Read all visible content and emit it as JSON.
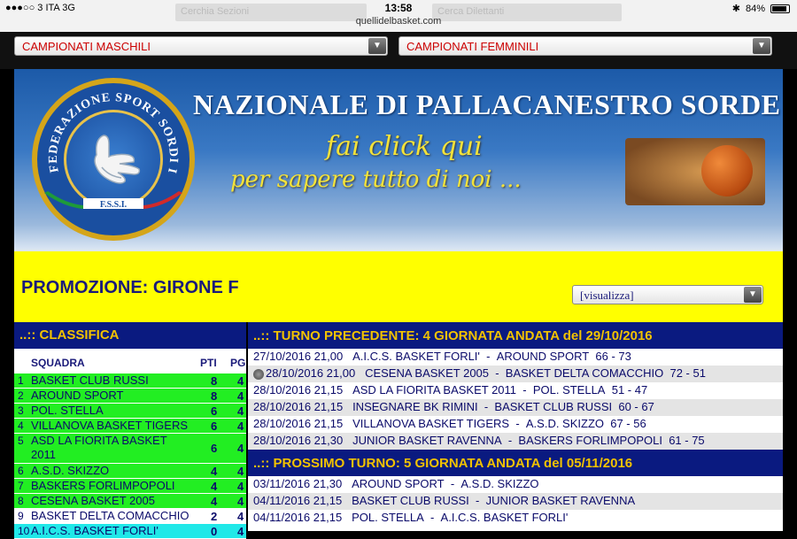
{
  "status_bar": {
    "carrier": "●●●○○ 3 ITA  3G",
    "time": "13:58",
    "url": "quellidelbasket.com",
    "bluetooth": "✱",
    "battery": "84%"
  },
  "top_nav": {
    "ghost_left": "Cerchia Sezioni",
    "ghost_right": "Cerca Dilettanti",
    "maschili": "CAMPIONATI MASCHILI",
    "femminili": "CAMPIONATI FEMMINILI"
  },
  "banner": {
    "seal_text": "FEDERAZIONE SPORT SORDI ITALIA",
    "seal_abbr": "F.S.S.I.",
    "title": "NAZIONALE DI PALLACANESTRO SORDE",
    "line1": "fai click qui",
    "line2": "per sapere tutto di noi ..."
  },
  "league": {
    "title": "PROMOZIONE: GIRONE F",
    "select_value": "[visualizza]"
  },
  "classifica": {
    "title": "..:: CLASSIFICA",
    "col_team": "SQUADRA",
    "col_pti": "PTI",
    "col_pg": "PG",
    "rows": [
      {
        "pos": "1",
        "team": "BASKET CLUB RUSSI",
        "pti": "8",
        "pg": "4"
      },
      {
        "pos": "2",
        "team": "AROUND SPORT",
        "pti": "8",
        "pg": "4"
      },
      {
        "pos": "3",
        "team": "POL. STELLA",
        "pti": "6",
        "pg": "4"
      },
      {
        "pos": "4",
        "team": "VILLANOVA BASKET TIGERS",
        "pti": "6",
        "pg": "4"
      },
      {
        "pos": "5",
        "team": "ASD LA FIORITA BASKET 2011",
        "pti": "6",
        "pg": "4"
      },
      {
        "pos": "6",
        "team": "A.S.D. SKIZZO",
        "pti": "4",
        "pg": "4"
      },
      {
        "pos": "7",
        "team": "BASKERS FORLIMPOPOLI",
        "pti": "4",
        "pg": "4"
      },
      {
        "pos": "8",
        "team": "CESENA BASKET 2005",
        "pti": "4",
        "pg": "4"
      },
      {
        "pos": "9",
        "team": "BASKET DELTA COMACCHIO",
        "pti": "2",
        "pg": "4"
      },
      {
        "pos": "10",
        "team": "A.I.C.S. BASKET FORLI'",
        "pti": "0",
        "pg": "4"
      }
    ]
  },
  "turno_precedente": {
    "title": "..:: TURNO PRECEDENTE:  4 GIORNATA ANDATA del 29/10/2016",
    "matches": [
      {
        "datetime": "27/10/2016 21,00",
        "home": "A.I.C.S. BASKET FORLI'",
        "away": "AROUND SPORT",
        "score": "66 - 73"
      },
      {
        "datetime": "28/10/2016 21,00",
        "home": "CESENA BASKET 2005",
        "away": "BASKET DELTA COMACCHIO",
        "score": "72 - 51"
      },
      {
        "datetime": "28/10/2016 21,15",
        "home": "ASD LA FIORITA BASKET 2011",
        "away": "POL. STELLA",
        "score": "51 - 47"
      },
      {
        "datetime": "28/10/2016 21,15",
        "home": "INSEGNARE BK RIMINI",
        "away": "BASKET CLUB RUSSI",
        "score": "60 - 67"
      },
      {
        "datetime": "28/10/2016 21,15",
        "home": "VILLANOVA BASKET TIGERS",
        "away": "A.S.D. SKIZZO",
        "score": "67 - 56"
      },
      {
        "datetime": "28/10/2016 21,30",
        "home": "JUNIOR BASKET RAVENNA",
        "away": "BASKERS FORLIMPOPOLI",
        "score": "61 - 75"
      }
    ]
  },
  "prossimo_turno": {
    "title": "..:: PROSSIMO TURNO:  5 GIORNATA ANDATA del 05/11/2016",
    "matches": [
      {
        "datetime": "03/11/2016 21,30",
        "home": "AROUND SPORT",
        "away": "A.S.D. SKIZZO"
      },
      {
        "datetime": "04/11/2016 21,15",
        "home": "BASKET CLUB RUSSI",
        "away": "JUNIOR BASKET RAVENNA"
      },
      {
        "datetime": "04/11/2016 21,15",
        "home": "POL. STELLA",
        "away": "A.I.C.S. BASKET FORLI'"
      }
    ]
  },
  "colors": {
    "nav_blue": "#0a1a80",
    "header_gold": "#f2c200",
    "highlight_yellow": "#ffff00",
    "standing_green": "#22ee22",
    "standing_cyan": "#20e8e8",
    "dropdown_red": "#cc0000"
  }
}
